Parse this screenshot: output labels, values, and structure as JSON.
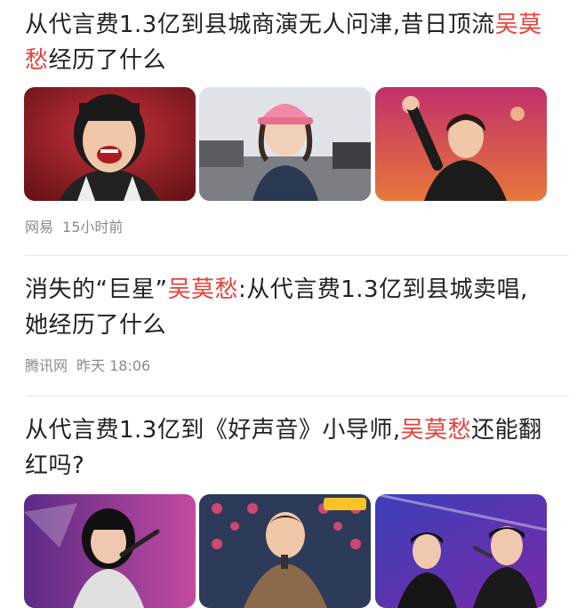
{
  "feed": {
    "articles": [
      {
        "title_before": "从代言费1.3亿到县城商演无人问津,昔日顶流",
        "title_highlight": "吴莫愁",
        "title_after": "经历了什么",
        "source": "网易",
        "time": "15小时前",
        "thumbnails": [
          {
            "desc": "singer-shouting-red-background"
          },
          {
            "desc": "singer-pink-cap-outdoor"
          },
          {
            "desc": "singer-on-stage-fist-raised"
          }
        ]
      },
      {
        "title_before": "消失的“巨星”",
        "title_highlight": "吴莫愁",
        "title_after": ":从代言费1.3亿到县城卖唱,她经历了什么",
        "source": "腾讯网",
        "time": "昨天 18:06"
      },
      {
        "title_before": "从代言费1.3亿到《好声音》小导师,",
        "title_highlight": "吴莫愁",
        "title_after": "还能翻红吗?",
        "thumbnails": [
          {
            "desc": "singer-microphone-purple-stage"
          },
          {
            "desc": "host-microphone-press-wall"
          },
          {
            "desc": "two-singers-blue-stage"
          }
        ]
      }
    ]
  },
  "colors": {
    "highlight": "#e8413a",
    "meta": "#8a8a8a",
    "divider": "#e8e8e8"
  }
}
